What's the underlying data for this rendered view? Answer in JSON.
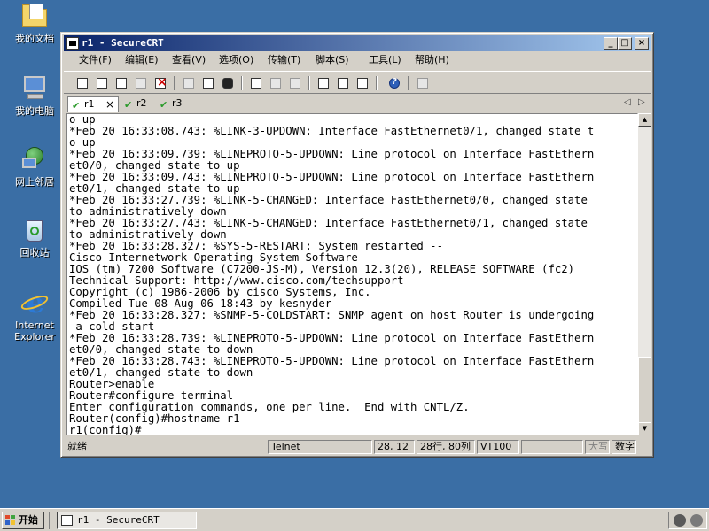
{
  "desktop": {
    "icons": [
      {
        "label": "我的文档"
      },
      {
        "label": "我的电脑"
      },
      {
        "label": "网上邻居"
      },
      {
        "label": "回收站"
      },
      {
        "label": "Internet Explorer"
      }
    ]
  },
  "window": {
    "title": "r1 - SecureCRT",
    "controls": {
      "minimize": "_",
      "maximize": "□",
      "close": "×"
    }
  },
  "menu": {
    "file": "文件(F)",
    "edit": "编辑(E)",
    "view": "查看(V)",
    "options": "选项(O)",
    "transfer": "传输(T)",
    "script": "脚本(S)",
    "tools": "工具(L)",
    "help": "帮助(H)"
  },
  "toolbar": {
    "icons": [
      "connect-icon",
      "quick-connect-icon",
      "connect-in-tab-icon",
      "reconnect-icon",
      "disconnect-icon",
      "copy-icon",
      "paste-icon",
      "find-icon",
      "print-icon",
      "print-setup-icon",
      "print-screen-icon",
      "session-options-icon",
      "global-options-icon",
      "keymap-icon",
      "help-icon",
      "sftp-icon"
    ]
  },
  "tabs": [
    {
      "label": "r1",
      "close": "×"
    },
    {
      "label": "r2"
    },
    {
      "label": "r3"
    }
  ],
  "tab_nav": {
    "prev": "◁",
    "next": "▷"
  },
  "terminal": {
    "lines": [
      "o up",
      "*Feb 20 16:33:08.743: %LINK-3-UPDOWN: Interface FastEthernet0/1, changed state t",
      "o up",
      "*Feb 20 16:33:09.739: %LINEPROTO-5-UPDOWN: Line protocol on Interface FastEthern",
      "et0/0, changed state to up",
      "*Feb 20 16:33:09.743: %LINEPROTO-5-UPDOWN: Line protocol on Interface FastEthern",
      "et0/1, changed state to up",
      "*Feb 20 16:33:27.739: %LINK-5-CHANGED: Interface FastEthernet0/0, changed state",
      "to administratively down",
      "*Feb 20 16:33:27.743: %LINK-5-CHANGED: Interface FastEthernet0/1, changed state",
      "to administratively down",
      "*Feb 20 16:33:28.327: %SYS-5-RESTART: System restarted --",
      "Cisco Internetwork Operating System Software",
      "IOS (tm) 7200 Software (C7200-JS-M), Version 12.3(20), RELEASE SOFTWARE (fc2)",
      "Technical Support: http://www.cisco.com/techsupport",
      "Copyright (c) 1986-2006 by cisco Systems, Inc.",
      "Compiled Tue 08-Aug-06 18:43 by kesnyder",
      "*Feb 20 16:33:28.327: %SNMP-5-COLDSTART: SNMP agent on host Router is undergoing",
      " a cold start",
      "*Feb 20 16:33:28.739: %LINEPROTO-5-UPDOWN: Line protocol on Interface FastEthern",
      "et0/0, changed state to down",
      "*Feb 20 16:33:28.743: %LINEPROTO-5-UPDOWN: Line protocol on Interface FastEthern",
      "et0/1, changed state to down",
      "Router>enable",
      "Router#configure terminal",
      "Enter configuration commands, one per line.  End with CNTL/Z.",
      "Router(config)#hostname r1",
      "r1(config)#"
    ]
  },
  "scrollbar": {
    "up": "▲",
    "down": "▼"
  },
  "status": {
    "ready": "就绪",
    "protocol": "Telnet",
    "cursor": "28, 12",
    "size": "28行, 80列",
    "emulation": "VT100",
    "caps": "大写",
    "num": "数字"
  },
  "taskbar": {
    "start": "开始",
    "task": "r1 - SecureCRT"
  },
  "colors": {
    "desktop": "#3a6ea5",
    "titlebar_start": "#0a246a",
    "titlebar_end": "#a6caf0",
    "tab_check": "#2a9a2a"
  }
}
